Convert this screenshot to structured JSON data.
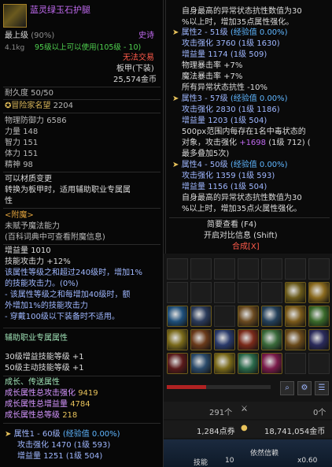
{
  "item": {
    "name": "蓝灵绿玉石护腿",
    "level_label": "最上级",
    "level_pct": "(90%)",
    "rarity": "史诗",
    "weight": "4.1kg",
    "req": "95级以上可以使用(105级 - 10)",
    "trade": "无法交易",
    "slot_type": "板甲(下装)",
    "price": "25,574金币",
    "durability": "耐久度 50/50",
    "fame_label": "冒险家名望",
    "fame_value": "2204",
    "stats": [
      {
        "name": "物理防御力",
        "value": "6586"
      },
      {
        "name": "力量",
        "value": "148"
      },
      {
        "name": "智力",
        "value": "151"
      },
      {
        "name": "体力",
        "value": "151"
      },
      {
        "name": "精神",
        "value": "98"
      }
    ],
    "material_change": "可以材质变更",
    "material_note1": "转换为板甲时，适用辅助职业专属属",
    "material_note2": "性",
    "enchant_title": "<附魔>",
    "enchant_1": "未赋予魔法能力",
    "enchant_2": "(百科词典中可查看附魔信息)",
    "amp_label": "增益量",
    "amp_value": "1010",
    "skill_atk_label": "技能攻击力",
    "skill_atk_value": "+12%",
    "desc1": "该属性等级之和超过240级时，增加1%",
    "desc2": "的技能攻击力。(0%)",
    "desc3": "- 该属性等级之和每增加40级时，额",
    "desc4": "外增加1%的技能攻击力",
    "desc5": "- 穿戴100级以下装备时不适用。",
    "support_title": "辅助职业专属属性",
    "support_1": "30级增益技能等级 +1",
    "support_2": "50级主动技能等级 +1",
    "growth_title": "成长、传送属性",
    "growth_1_label": "成长属性总攻击强化",
    "growth_1_value": "9419",
    "growth_2_label": "成长属性总增益量",
    "growth_2_value": "4784",
    "growth_3_label": "成长属性总等级",
    "growth_3_value": "218",
    "attr1_title": "属性1 - 60级",
    "attr1_exp": "(经验值 0.00%)",
    "attr1_atk_label": "攻击强化",
    "attr1_atk_value": "1470",
    "attr1_atk_extra": "(1级 593)",
    "attr1_amp_label": "增益量",
    "attr1_amp_value": "1251",
    "attr1_amp_extra": "(1级 504)"
  },
  "right_tip": {
    "top1": "自身最高的异常状态抗性数值为30",
    "top2": "%以上时，增加35点属性强化。",
    "attr2_title": "属性2 - 51级",
    "attr2_exp": "(经验值 0.00%)",
    "attr2_atk": "攻击强化",
    "attr2_atk_v": "3760",
    "attr2_atk_x": "(1级 1630)",
    "attr2_amp": "增益量",
    "attr2_amp_v": "1174",
    "attr2_amp_x": "(1级 509)",
    "phys_crit": "物理暴击率 +7%",
    "mag_crit": "魔法暴击率 +7%",
    "resist": "所有异常状态抗性 -10%",
    "attr3_title": "属性3 - 57级",
    "attr3_exp": "(经验值 0.00%)",
    "attr3_atk": "攻击强化",
    "attr3_atk_v": "2830",
    "attr3_atk_x": "(1级 1186)",
    "attr3_amp": "增益量",
    "attr3_amp_v": "1203",
    "attr3_amp_x": "(1级 504)",
    "poison1": "500px范围内每存在1名中毒状态的",
    "poison2a": "对象，攻击强化",
    "poison2b": "+1698",
    "poison2c": "(1级 712) (",
    "poison3": "最多叠加5次)",
    "attr4_title": "属性4 - 50级",
    "attr4_exp": "(经验值 0.00%)",
    "attr4_atk": "攻击强化",
    "attr4_atk_v": "1359",
    "attr4_atk_x": "(1级 593)",
    "attr4_amp": "增益量",
    "attr4_amp_v": "1156",
    "attr4_amp_x": "(1级 504)",
    "bot1": "自身最高的异常状态抗性数值为30",
    "bot2": "%以上时，增加35点火属性强化。",
    "simple_view": "简要查看 (F4)",
    "compare": "开启对比信息 (Shift)",
    "synth": "合成[X]"
  },
  "inventory": {
    "count1": "291个",
    "count2": "0个",
    "points": "1,284点券",
    "gold": "18,741,054金币",
    "skill_label": "技能",
    "skill_num": "10",
    "notice": "依然信赖",
    "bar_value": "x0.60"
  },
  "colors": {
    "gold": "#e7c25b",
    "green": "#4fd14f",
    "blue": "#3f9bff",
    "purple": "#c06af0",
    "pink": "#ff6f8a"
  }
}
